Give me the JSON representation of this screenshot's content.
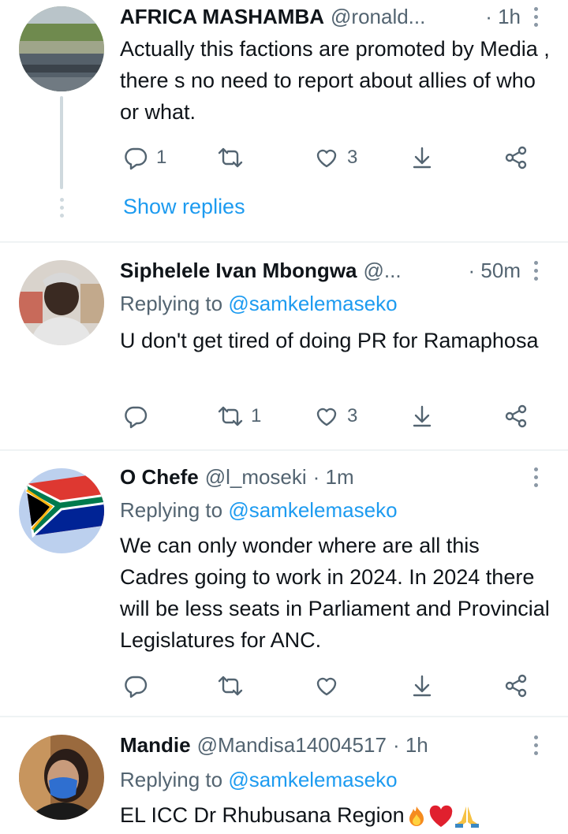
{
  "tweets": [
    {
      "name": "AFRICA MASHAMBA",
      "handle": "@ronald...",
      "time": "· 1h",
      "replying_label": "",
      "replying_mention": "",
      "body": "Actually this factions are promoted by Media , there s no need to report about allies of who or what.",
      "reply_count": "1",
      "retweet_count": "",
      "like_count": "3"
    },
    {
      "name": "Siphelele Ivan Mbongwa",
      "handle": "@...",
      "time": "· 50m",
      "replying_label": "Replying to",
      "replying_mention": "@samkelemaseko",
      "body": "U don't get tired of doing PR for Ramaphosa",
      "reply_count": "",
      "retweet_count": "1",
      "like_count": "3"
    },
    {
      "name": "O Chefe",
      "handle": "@l_moseki",
      "time": "· 1m",
      "replying_label": "Replying to",
      "replying_mention": "@samkelemaseko",
      "body": "We can only wonder where are all this Cadres going to work in 2024. In 2024 there will be less seats in Parliament and Provincial Legislatures for ANC.",
      "reply_count": "",
      "retweet_count": "",
      "like_count": ""
    },
    {
      "name": "Mandie",
      "handle": "@Mandisa14004517",
      "time": "· 1h",
      "replying_label": "Replying to",
      "replying_mention": "@samkelemaseko",
      "body": "EL ICC Dr Rhubusana Region",
      "reply_count": "",
      "retweet_count": "",
      "like_count": ""
    }
  ],
  "show_replies_label": "Show replies",
  "icons": [
    "reply-icon",
    "retweet-icon",
    "like-icon",
    "bookmark-download-icon",
    "share-icon",
    "more-vertical-icon",
    "fire-emoji",
    "heart-emoji",
    "pray-emoji"
  ],
  "colors": {
    "link": "#1d9bf0",
    "muted": "#536471",
    "text": "#0f1419",
    "divider": "#eff3f4"
  }
}
